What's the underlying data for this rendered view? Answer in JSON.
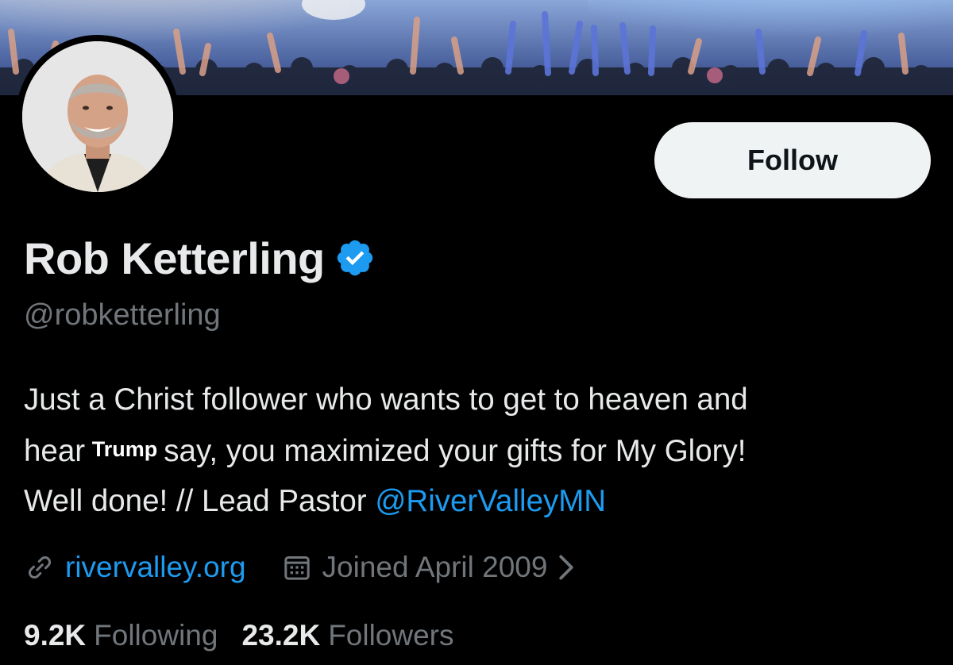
{
  "profile": {
    "name": "Rob Ketterling",
    "handle": "@robketterling",
    "verified": true,
    "follow_label": "Follow",
    "bio_line1": "Just a Christ follower who wants to get to heaven and",
    "bio_line2_start": "hear",
    "bio_overlay_word": "Trump",
    "bio_line2_end": "say, you maximized your gifts for My Glory!",
    "bio_line3_start": "Well done! // Lead Pastor ",
    "bio_mention": "@RiverValleyMN",
    "website": "rivervalley.org",
    "joined": "Joined April 2009",
    "following_count": "9.2K",
    "following_label": "Following",
    "followers_count": "23.2K",
    "followers_label": "Followers"
  },
  "icons": {
    "verified": "verified-badge-icon",
    "link": "link-icon",
    "calendar": "calendar-icon",
    "chevron": "chevron-right-icon"
  },
  "colors": {
    "background": "#000000",
    "text": "#e7e9ea",
    "secondary": "#71767b",
    "accent": "#1d9bf0",
    "button_bg": "#eff3f4"
  }
}
